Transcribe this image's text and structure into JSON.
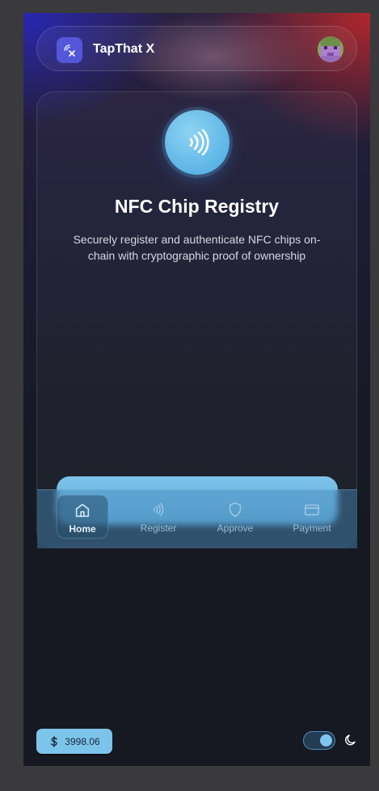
{
  "app": {
    "name": "TapThat X"
  },
  "hero": {
    "title": "NFC Chip Registry",
    "description": "Securely register and authenticate NFC chips on-chain with cryptographic proof of ownership"
  },
  "nav": {
    "items": [
      {
        "label": "Home",
        "icon": "home-icon",
        "active": true
      },
      {
        "label": "Register",
        "icon": "nfc-icon",
        "active": false
      },
      {
        "label": "Approve",
        "icon": "shield-icon",
        "active": false
      },
      {
        "label": "Payment",
        "icon": "credit-card-icon",
        "active": false
      }
    ]
  },
  "footer": {
    "balance": "3998.06",
    "currency_icon": "dollar-icon",
    "theme_toggle_on": true,
    "theme_icon": "moon-icon"
  },
  "colors": {
    "accent": "#7dc4ea",
    "logo_bg": "#5457d9",
    "background": "#161922"
  }
}
